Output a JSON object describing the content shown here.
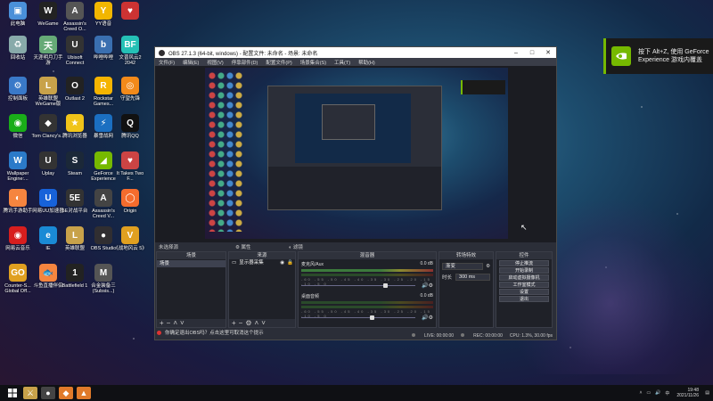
{
  "desktop": {
    "icons": [
      {
        "label": "此电脑",
        "glyph": "▣",
        "color": "#4a90d9"
      },
      {
        "label": "WeGame",
        "glyph": "W",
        "color": "#222"
      },
      {
        "label": "Assassin's Creed O...",
        "glyph": "A",
        "color": "#555"
      },
      {
        "label": "YY语音",
        "glyph": "Y",
        "color": "#f2b600"
      },
      {
        "label": "",
        "glyph": "♥",
        "color": "#c33"
      },
      {
        "label": "回收站",
        "glyph": "♻",
        "color": "#8aa"
      },
      {
        "label": "天涯明月刀手游",
        "glyph": "天",
        "color": "#6a7"
      },
      {
        "label": "Ubisoft Connect",
        "glyph": "U",
        "color": "#333"
      },
      {
        "label": "哔哩哔哩",
        "glyph": "b",
        "color": "#3a6fb0"
      },
      {
        "label": "文晋风云2 2042",
        "glyph": "BF",
        "color": "#25c1b6"
      },
      {
        "label": "控制面板",
        "glyph": "⚙",
        "color": "#3a79c8"
      },
      {
        "label": "英雄联盟 WeGame版",
        "glyph": "L",
        "color": "#c8a24a"
      },
      {
        "label": "Outlast 2",
        "glyph": "O",
        "color": "#222"
      },
      {
        "label": "Rockstar Games...",
        "glyph": "R",
        "color": "#f5b400"
      },
      {
        "label": "守望先锋",
        "glyph": "◎",
        "color": "#f28a1a"
      },
      {
        "label": "微信",
        "glyph": "◉",
        "color": "#1aad19"
      },
      {
        "label": "Tom Clancy's...",
        "glyph": "◆",
        "color": "#333"
      },
      {
        "label": "腾讯浏览器",
        "glyph": "★",
        "color": "#f0c419"
      },
      {
        "label": "暴雪战网",
        "glyph": "⚡",
        "color": "#1b6fc1"
      },
      {
        "label": "腾讯QQ",
        "glyph": "Q",
        "color": "#111"
      },
      {
        "label": "Wallpaper Engine:...",
        "glyph": "W",
        "color": "#2b7ac9"
      },
      {
        "label": "Uplay",
        "glyph": "U",
        "color": "#333"
      },
      {
        "label": "Steam",
        "glyph": "S",
        "color": "#1b2838"
      },
      {
        "label": "GeForce Experience",
        "glyph": "◢",
        "color": "#76b900"
      },
      {
        "label": "It Takes Two F...",
        "glyph": "♥",
        "color": "#c44"
      },
      {
        "label": "腾讯手游助手",
        "glyph": "◐",
        "color": "#f5853f"
      },
      {
        "label": "网易UU加速器",
        "glyph": "U",
        "color": "#1762d9"
      },
      {
        "label": "5E对战平台",
        "glyph": "5E",
        "color": "#333"
      },
      {
        "label": "Assassin's Creed V...",
        "glyph": "A",
        "color": "#444"
      },
      {
        "label": "Origin",
        "glyph": "◯",
        "color": "#f56c2d"
      },
      {
        "label": "网易云音乐",
        "glyph": "◉",
        "color": "#d71e1e"
      },
      {
        "label": "IE",
        "glyph": "e",
        "color": "#1a8ad5"
      },
      {
        "label": "英雄联盟",
        "glyph": "L",
        "color": "#c8a24a"
      },
      {
        "label": "OBS Studio",
        "glyph": "●",
        "color": "#302e31"
      },
      {
        "label": "《战地风云 5》",
        "glyph": "V",
        "color": "#e0a020"
      },
      {
        "label": "Counter-S... Global Off...",
        "glyph": "GO",
        "color": "#e0a020"
      },
      {
        "label": "斗鱼直播伴侣",
        "glyph": "🐟",
        "color": "#f5853f"
      },
      {
        "label": "Battlefield 1",
        "glyph": "1",
        "color": "#222"
      },
      {
        "label": "合金装备三 (Subsis...)",
        "glyph": "M",
        "color": "#555"
      }
    ]
  },
  "notification": {
    "line1": "按下 Alt+Z, 使用 GeForce",
    "line2": "Experience 游戏内覆盖"
  },
  "obs": {
    "title": "OBS 27.1.3 (64-bit, windows) - 配置文件: 未命名 - 场景: 未命名",
    "menu": [
      "文件(F)",
      "编辑(E)",
      "视图(V)",
      "停靠部件(D)",
      "配置文件(P)",
      "场景集合(S)",
      "工具(T)",
      "帮助(H)"
    ],
    "tabs": {
      "no_source": "未选择源",
      "properties": "属性",
      "filters": "滤镜"
    },
    "scenes": {
      "header": "场景",
      "items": [
        "场景"
      ]
    },
    "sources": {
      "header": "来源",
      "items": [
        "显示器采集"
      ]
    },
    "mixer": {
      "header": "混音器",
      "channels": [
        {
          "name": "麦克风/Aux",
          "db": "0.0 dB",
          "scale": "-60 -55 -50 -45 -40 -35 -30 -25 -20 -15 -10 -5 0",
          "level": 0.72
        },
        {
          "name": "桌面音频",
          "db": "0.0 dB",
          "scale": "-60 -55 -50 -45 -40 -35 -30 -25 -20 -15 -10 -5 0",
          "level": 0.6
        }
      ]
    },
    "transitions": {
      "header": "转场特效",
      "selected": "渐变",
      "duration_label": "时长",
      "duration": "300 ms"
    },
    "controls": {
      "header": "控件",
      "buttons": [
        "停止推流",
        "开始录制",
        "启动虚拟摄像机",
        "工作室模式",
        "设置",
        "退出"
      ]
    },
    "status": {
      "live": "LIVE: 00:00:00",
      "rec": "REC: 00:00:00",
      "cpu": "CPU: 1.3%, 30.00 fps"
    },
    "notice": "你确定退出OBS吗？点击这里可取消这个提示"
  },
  "taskbar": {
    "time": "19:48",
    "date": "2021/11/26",
    "lang": "中"
  }
}
